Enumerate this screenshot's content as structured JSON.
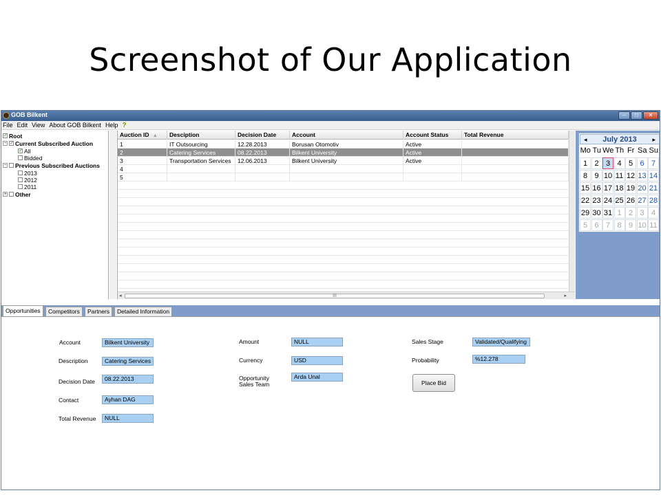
{
  "slide_title": "Screenshot of Our Application",
  "window": {
    "title": "GOB Bilkent",
    "minimize_glyph": "–",
    "maximize_glyph": "□",
    "close_glyph": "✕"
  },
  "menu": {
    "items": [
      "File",
      "Edit",
      "View",
      "About GOB Bilkent",
      "Help"
    ],
    "help_icon": "?"
  },
  "tree": {
    "nodes": [
      {
        "label": "Root",
        "expander": "",
        "checked": true
      },
      {
        "label": "Current Subscribed Auction",
        "expander": "−",
        "checked": true
      },
      {
        "label": "All",
        "expander": "",
        "checked": true
      },
      {
        "label": "Bidded",
        "expander": "",
        "checked": false
      },
      {
        "label": "Previous Subscribed Auctions",
        "expander": "−",
        "checked": false
      },
      {
        "label": "2013",
        "expander": "",
        "checked": false
      },
      {
        "label": "2012",
        "expander": "",
        "checked": false
      },
      {
        "label": "2011",
        "expander": "",
        "checked": false
      },
      {
        "label": "Other",
        "expander": "+",
        "checked": false
      }
    ]
  },
  "grid": {
    "columns": [
      "Auction ID",
      "Desciption",
      "Decision Date",
      "Account",
      "Account Status",
      "Total Revenue"
    ],
    "sort_indicator": "▲",
    "rows": [
      [
        "1",
        "IT Outsourcing",
        "12.28.2013",
        "Borusan Otomotiv",
        "Active",
        ""
      ],
      [
        "2",
        "Catering Services",
        "08.22.2013",
        "Bilkent University",
        "Active",
        ""
      ],
      [
        "3",
        "Transportation Services",
        "12.06.2013",
        "Bilkent University",
        "Active",
        ""
      ],
      [
        "4",
        "",
        "",
        "",
        "",
        ""
      ],
      [
        "5",
        "",
        "",
        "",
        "",
        ""
      ]
    ],
    "selected_row_index": 1,
    "scroll_grip": "III",
    "scroll_left": "◂",
    "scroll_right": "▸"
  },
  "calendar": {
    "title": "July 2013",
    "prev": "◂",
    "next": "▸",
    "weekdays": [
      "Mo",
      "Tu",
      "We",
      "Th",
      "Fr",
      "Sa",
      "Su"
    ],
    "weeks": [
      [
        "1",
        "2",
        "3",
        "4",
        "5",
        "6",
        "7"
      ],
      [
        "8",
        "9",
        "10",
        "11",
        "12",
        "13",
        "14"
      ],
      [
        "15",
        "16",
        "17",
        "18",
        "19",
        "20",
        "21"
      ],
      [
        "22",
        "23",
        "24",
        "25",
        "26",
        "27",
        "28"
      ],
      [
        "29",
        "30",
        "31",
        "1",
        "2",
        "3",
        "4"
      ],
      [
        "5",
        "6",
        "7",
        "8",
        "9",
        "10",
        "11"
      ]
    ],
    "today": "3"
  },
  "tabs": [
    "Opportunities",
    "Competitors",
    "Partners",
    "Detailed Information"
  ],
  "details": {
    "account_label": "Account",
    "account_value": "Bilkent University",
    "description_label": "Description",
    "description_value": "Catering Services",
    "decision_date_label": "Decision Date",
    "decision_date_value": "08.22.2013",
    "contact_label": "Contact",
    "contact_value": "Ayhan DAG",
    "total_revenue_label": "Total Revenue",
    "total_revenue_value": "NULL",
    "amount_label": "Amount",
    "amount_value": "NULL",
    "currency_label": "Currency",
    "currency_value": "USD",
    "team_label_line1": "Opportunity",
    "team_label_line2": "Sales Team",
    "team_value": "Arda Unal",
    "sales_stage_label": "Sales Stage",
    "sales_stage_value": "Validated/Qualifying",
    "probability_label": "Probability",
    "probability_value": "%12.278",
    "place_bid_label": "Place Bid"
  }
}
